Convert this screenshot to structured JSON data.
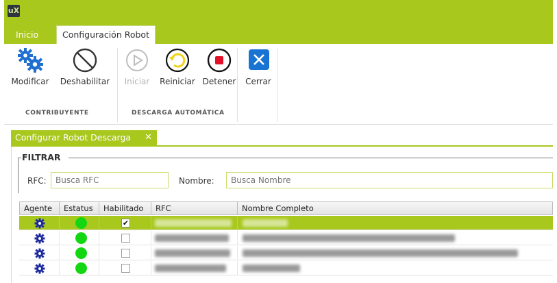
{
  "app": {
    "icon_text": "uX",
    "accent": "#a8c81e"
  },
  "tabs": {
    "inicio": "Inicio",
    "configuracion": "Configuración Robot"
  },
  "ribbon": {
    "groups": [
      {
        "label": "CONTRIBUYENTE"
      },
      {
        "label": "DESCARGA AUTOMÁTICA"
      }
    ],
    "buttons": {
      "modificar": "Modificar",
      "deshabilitar": "Deshabilitar",
      "iniciar": "Iniciar",
      "reiniciar": "Reiniciar",
      "detener": "Detener",
      "cerrar": "Cerrar"
    }
  },
  "document": {
    "tab_label": "Configurar Robot Descarga",
    "filter": {
      "title": "FILTRAR",
      "rfc_label": "RFC:",
      "rfc_placeholder": "Busca RFC",
      "nombre_label": "Nombre:",
      "nombre_placeholder": "Busca Nombre"
    },
    "grid": {
      "columns": [
        "Agente",
        "Estatus",
        "Habilitado",
        "RFC",
        "Nombre Completo"
      ],
      "rows": [
        {
          "habilitado": true,
          "selected": true
        },
        {
          "habilitado": false,
          "selected": false
        },
        {
          "habilitado": false,
          "selected": false
        },
        {
          "habilitado": false,
          "selected": false
        }
      ],
      "check_mark": "✔"
    }
  }
}
